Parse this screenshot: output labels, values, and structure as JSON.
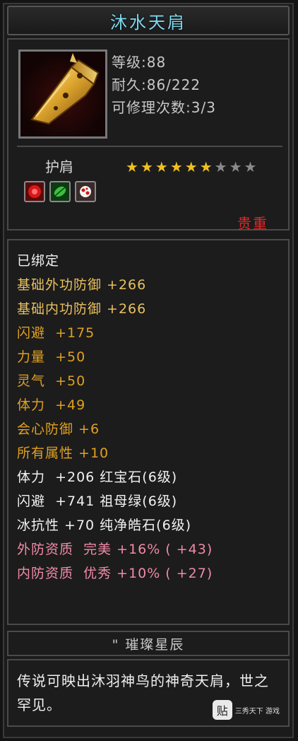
{
  "title": "沐水天肩",
  "stats": {
    "level": "等级:88",
    "durability": "耐久:86/222",
    "repairs": "可修理次数:3/3"
  },
  "item_type": "护肩",
  "stars": {
    "filled": 6,
    "total": 9,
    "filled_color": "#f0c020",
    "empty_color": "#8a8a8a"
  },
  "skill_icons": [
    "red-gem-icon",
    "green-leaf-icon",
    "white-red-flower-icon"
  ],
  "rarity": "贵重",
  "attributes": [
    {
      "text": "已绑定",
      "color": "#f2f2f2"
    },
    {
      "text": "基础外功防御 +266",
      "color": "#e8c060"
    },
    {
      "text": "基础内功防御 +266",
      "color": "#e8c060"
    },
    {
      "text": "闪避  +175",
      "color": "#e0a020"
    },
    {
      "text": "力量  +50",
      "color": "#e0a020"
    },
    {
      "text": "灵气  +50",
      "color": "#e0a020"
    },
    {
      "text": "体力  +49",
      "color": "#e0a020"
    },
    {
      "text": "会心防御 +6",
      "color": "#e0a020"
    },
    {
      "text": "所有属性 +10",
      "color": "#e0a020"
    },
    {
      "text": "体力  +206 红宝石(6级)",
      "color": "#f2f2f2"
    },
    {
      "text": "闪避  +741 祖母绿(6级)",
      "color": "#f2f2f2"
    },
    {
      "text": "冰抗性 +70 纯净皓石(6级)",
      "color": "#f2f2f2"
    },
    {
      "text": "外防资质  完美 +16% ( +43)",
      "color": "#f08aa8"
    },
    {
      "text": "内防资质  优秀 +10% ( +27)",
      "color": "#f08aa8"
    }
  ],
  "set_name": "\" 璀璨星辰",
  "description": "传说可映出沐羽神鸟的神奇天肩，世之罕见。",
  "watermark": {
    "logo": "贴",
    "text": "三秀天下 游戏"
  }
}
